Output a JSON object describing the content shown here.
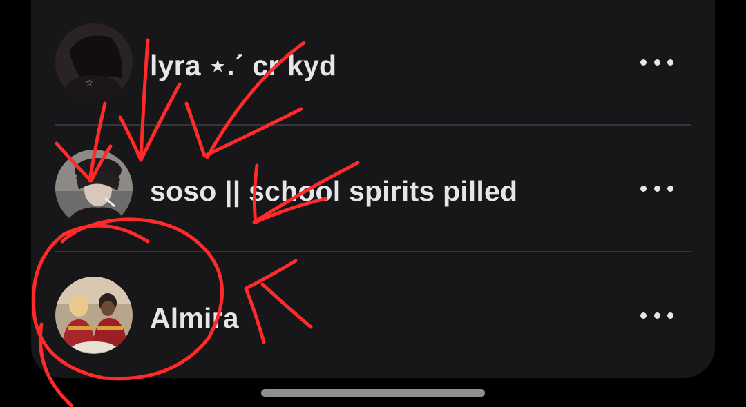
{
  "accounts": [
    {
      "name": "lyra ⋆.ˊ cr kyd",
      "avatar": "avatar-lyra"
    },
    {
      "name": "soso || school spirits pilled",
      "avatar": "avatar-soso"
    },
    {
      "name": "Almira",
      "avatar": "avatar-almira"
    }
  ],
  "colors": {
    "panel_background": "#171719",
    "text": "#e6e6e8",
    "divider": "#333538",
    "annotation_red": "#ff2a2a"
  },
  "icons": {
    "more": "more-horizontal-icon"
  }
}
